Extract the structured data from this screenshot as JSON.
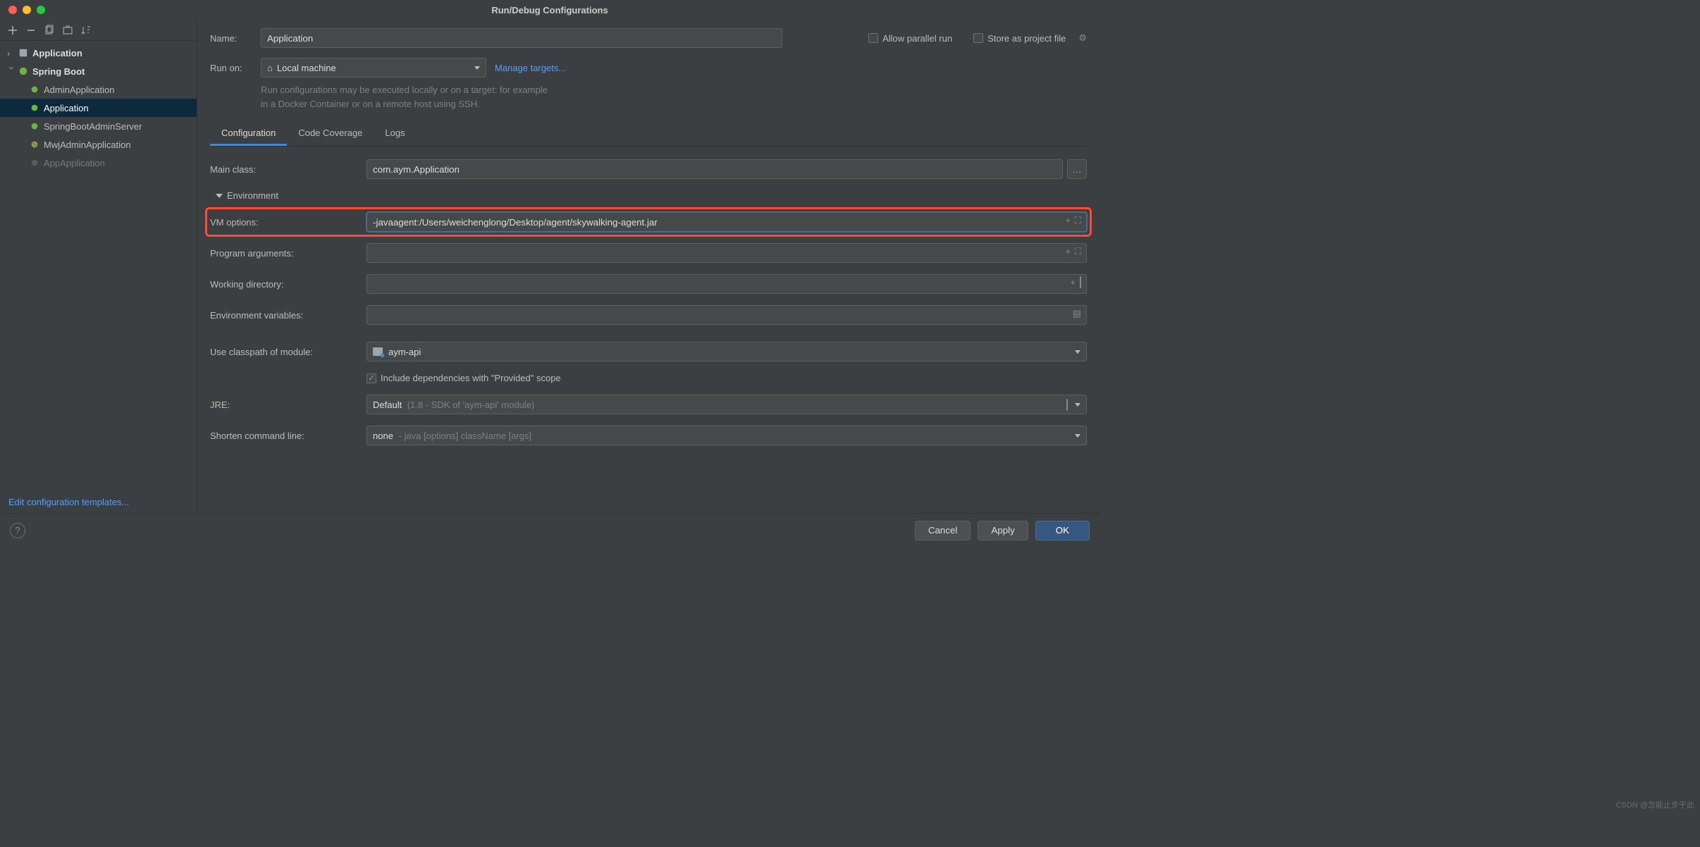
{
  "window": {
    "title": "Run/Debug Configurations"
  },
  "sidebar": {
    "rootGroup": "Application",
    "springGroup": "Spring Boot",
    "items": [
      {
        "label": "AdminApplication"
      },
      {
        "label": "Application"
      },
      {
        "label": "SpringBootAdminServer"
      },
      {
        "label": "MwjAdminApplication"
      },
      {
        "label": "AppApplication"
      }
    ],
    "editTemplates": "Edit configuration templates..."
  },
  "form": {
    "nameLabel": "Name:",
    "nameValue": "Application",
    "allowParallel": "Allow parallel run",
    "storeAsFile": "Store as project file",
    "runOnLabel": "Run on:",
    "runOnValue": "Local machine",
    "manageTargets": "Manage targets...",
    "hint": "Run configurations may be executed locally or on a target: for example in a Docker Container or on a remote host using SSH."
  },
  "tabs": {
    "configuration": "Configuration",
    "coverage": "Code Coverage",
    "logs": "Logs"
  },
  "config": {
    "mainClassLabel": "Main class:",
    "mainClassValue": "com.aym.Application",
    "environmentSection": "Environment",
    "vmOptionsLabel": "VM options:",
    "vmOptionsValue": "-javaagent:/Users/weichenglong/Desktop/agent/skywalking-agent.jar",
    "programArgsLabel": "Program arguments:",
    "programArgsValue": "",
    "workingDirLabel": "Working directory:",
    "workingDirValue": "",
    "envVarsLabel": "Environment variables:",
    "envVarsValue": "",
    "classpathLabel": "Use classpath of module:",
    "classpathValue": "aym-api",
    "includeProvided": "Include dependencies with \"Provided\" scope",
    "jreLabel": "JRE:",
    "jreValue": "Default",
    "jreHint": "(1.8 - SDK of 'aym-api' module)",
    "shortenLabel": "Shorten command line:",
    "shortenValue": "none",
    "shortenHint": "- java [options] className [args]"
  },
  "buttons": {
    "cancel": "Cancel",
    "apply": "Apply",
    "ok": "OK"
  },
  "watermark": "CSDN @怎能止步于此"
}
